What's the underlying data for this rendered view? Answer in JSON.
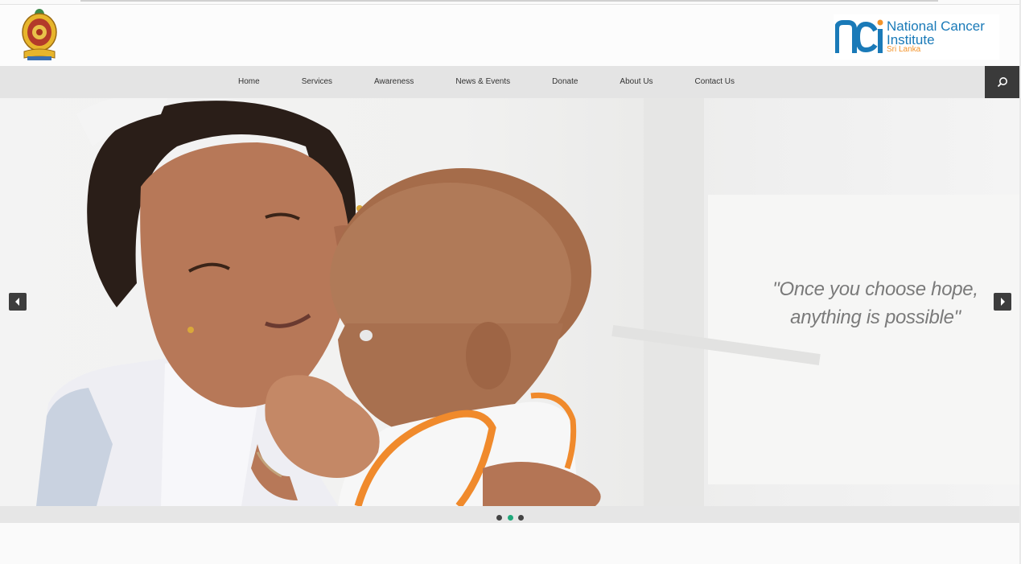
{
  "header": {
    "emblem_name": "sri-lanka-emblem",
    "logo": {
      "mark": "nci",
      "line1": "National Cancer",
      "line2": "Institute",
      "line3": "Sri Lanka",
      "colors": {
        "primary": "#1a7ab8",
        "accent": "#f3932a"
      }
    }
  },
  "nav": {
    "items": [
      {
        "label": "Home"
      },
      {
        "label": "Services"
      },
      {
        "label": "Awareness"
      },
      {
        "label": "News & Events"
      },
      {
        "label": "Donate"
      },
      {
        "label": "About Us"
      },
      {
        "label": "Contact Us"
      }
    ],
    "search_icon": "search-icon"
  },
  "slider": {
    "quote_line1": "\"Once you choose hope,",
    "quote_line2": "anything is possible\"",
    "prev_icon": "chevron-left-icon",
    "next_icon": "chevron-right-icon",
    "slide_count": 3,
    "active_slide": 2,
    "active_dot_color": "#1fa87a"
  }
}
